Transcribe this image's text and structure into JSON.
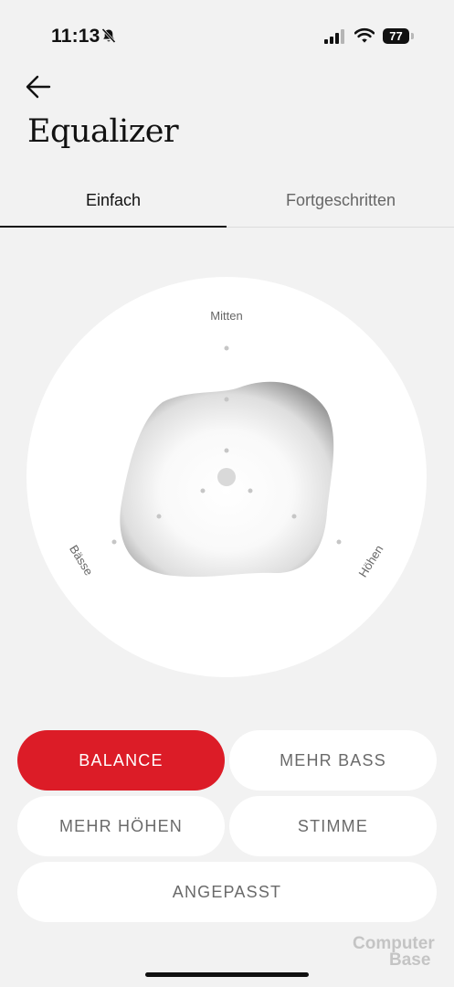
{
  "status_bar": {
    "time": "11:13",
    "battery": "77",
    "icons": [
      "bell-slash-icon",
      "cellular-signal-icon",
      "wifi-icon",
      "battery-icon"
    ]
  },
  "header": {
    "back_icon": "arrow-left-icon",
    "title": "Equalizer"
  },
  "tabs": [
    {
      "label": "Einfach",
      "selected": true
    },
    {
      "label": "Fortgeschritten",
      "selected": false
    }
  ],
  "equalizer": {
    "labels": {
      "mid": "Mitten",
      "bass": "Bässe",
      "treble": "Höhen"
    }
  },
  "presets": {
    "balance": "BALANCE",
    "more_bass": "MEHR BASS",
    "more_treble": "MEHR HÖHEN",
    "voice": "STIMME",
    "custom": "ANGEPASST",
    "selected": "balance"
  },
  "colors": {
    "accent": "#dc1c27",
    "background": "#f2f2f2",
    "card": "#ffffff"
  },
  "watermark": {
    "line1": "Computer",
    "line2": "Base"
  }
}
